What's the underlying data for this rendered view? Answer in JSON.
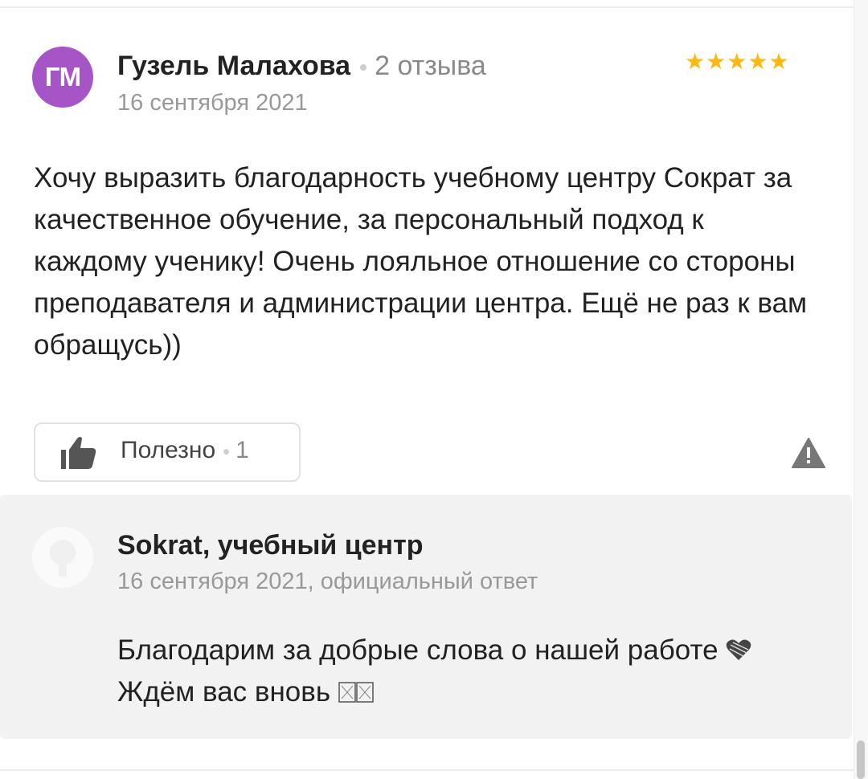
{
  "review": {
    "avatar_initials": "ГМ",
    "avatar_color": "#a555c5",
    "author_name": "Гузель Малахова",
    "author_reviews_count": "2 отзыва",
    "date": "16 сентября 2021",
    "rating": 5,
    "rating_stars": "★★★★★",
    "star_color": "#fdb913",
    "text": "Хочу выразить благодарность учебному центру Сократ за качественное обучение, за персональный подход к каждому ученику! Очень лояльное отношение со стороны преподавателя и администрации центра. Ещё не раз к вам обращусь))",
    "helpful_label": "Полезно",
    "helpful_count": "1",
    "helpful_icon": "thumbs-up-icon",
    "complain_icon": "warning-icon"
  },
  "reply": {
    "org_name": "Sokrat, учебный центр",
    "meta": "16 сентября 2021, официальный ответ",
    "text_part1": "Благодарим за добрые слова о нашей работе",
    "text_part2": "Ждём вас вновь",
    "heart_icon": "heart-icon",
    "trailing_icon": "unsupported-glyph-icon",
    "background_color": "#f2f2f2"
  }
}
